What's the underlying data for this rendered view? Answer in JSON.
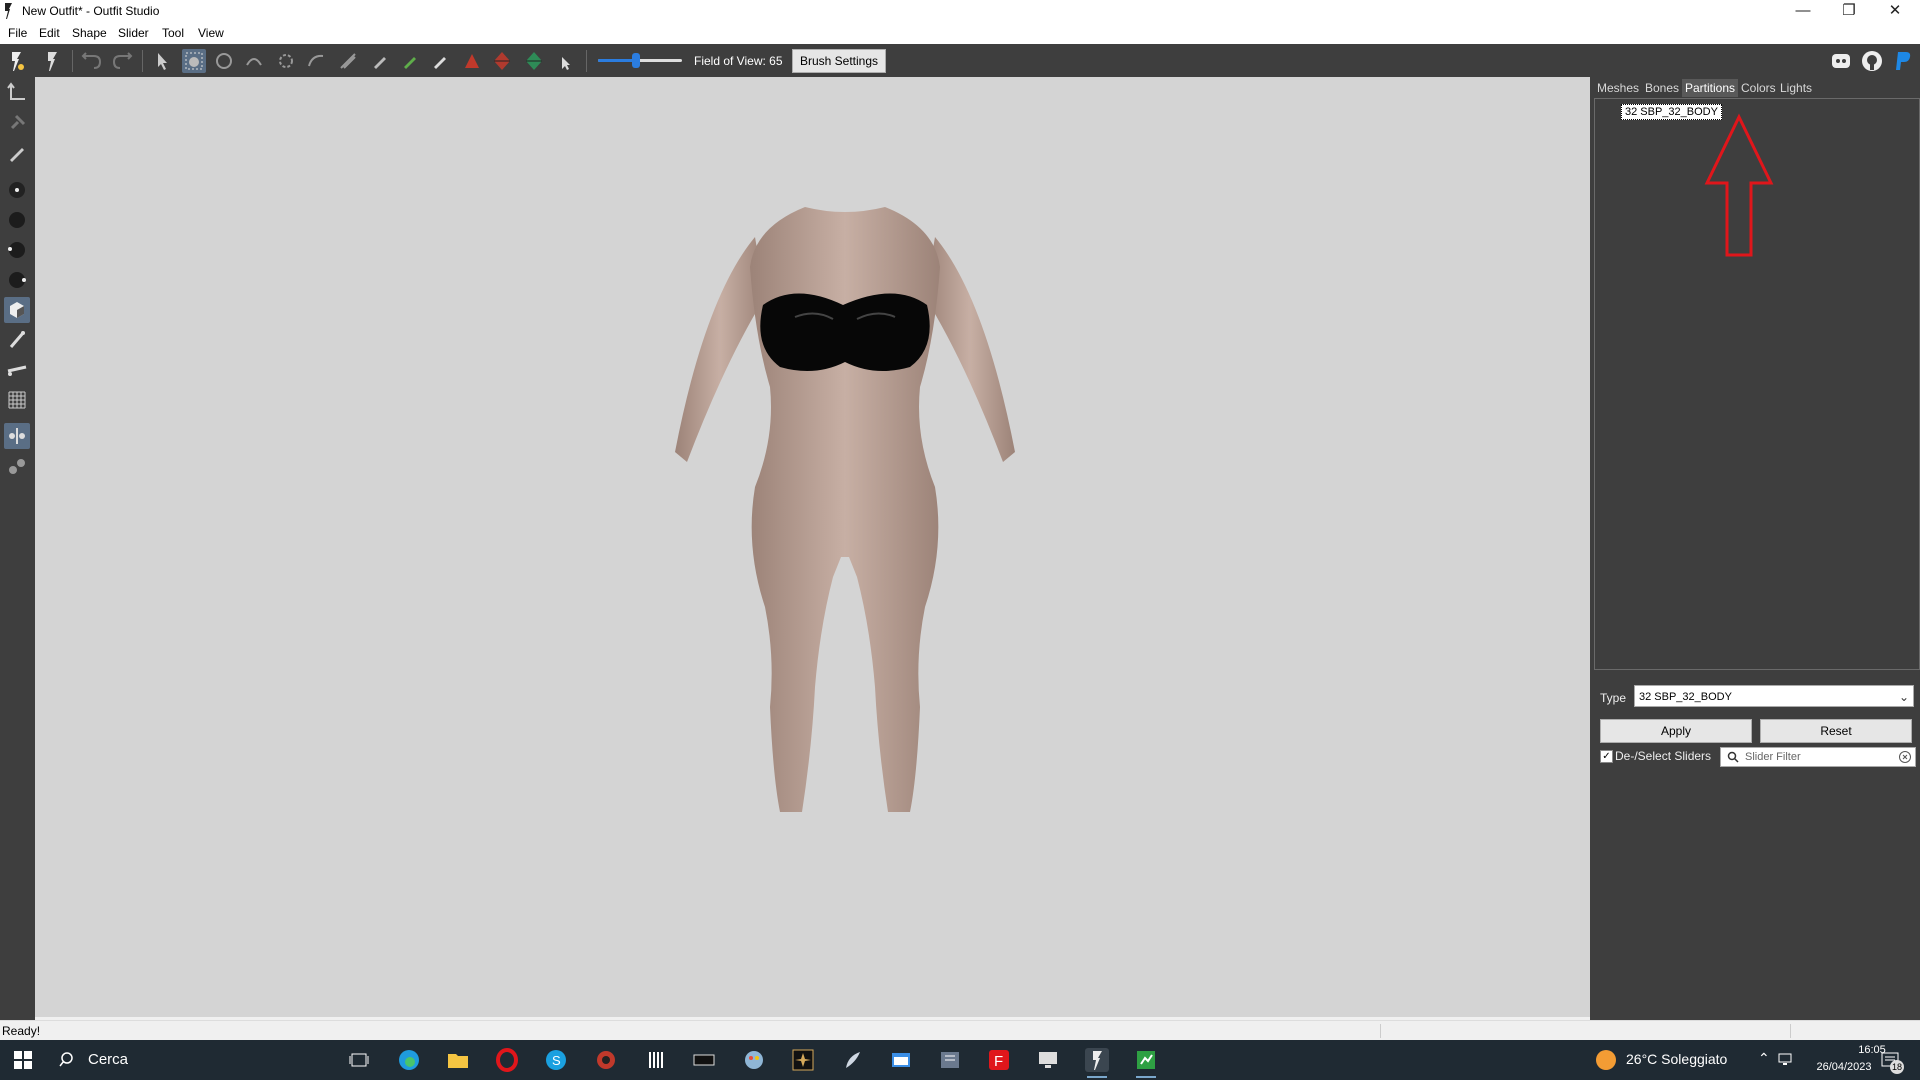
{
  "window": {
    "title": "New Outfit* - Outfit Studio",
    "minimize_icon": "minimize-icon",
    "maximize_icon": "restore-icon",
    "close_icon": "close-icon"
  },
  "menu": [
    "File",
    "Edit",
    "Shape",
    "Slider",
    "Tool",
    "View"
  ],
  "toolbar": {
    "fov_label": "Field of View: 65",
    "fov_value": 65,
    "brush_settings": "Brush Settings",
    "right_icons": [
      "discord-icon",
      "github-icon",
      "paypal-icon"
    ]
  },
  "right_panel": {
    "tabs": [
      "Meshes",
      "Bones",
      "Partitions",
      "Colors",
      "Lights"
    ],
    "active_tab": "Partitions",
    "partitions": [
      "32 SBP_32_BODY"
    ],
    "type_label": "Type",
    "type_value": "32 SBP_32_BODY",
    "apply": "Apply",
    "reset": "Reset",
    "deselect_sliders": "De-/Select Sliders",
    "slider_filter_placeholder": "Slider Filter"
  },
  "status": {
    "text": "Ready!"
  },
  "taskbar": {
    "search": "Cerca",
    "weather": "26°C Soleggiato",
    "time": "16:05",
    "date": "26/04/2023",
    "notifications": "18"
  },
  "colors": {
    "toolbar_bg": "#3e3e3e",
    "viewport_bg": "#d4d4d4",
    "accent": "#2b7de0",
    "annotation_arrow": "#e0161b"
  }
}
